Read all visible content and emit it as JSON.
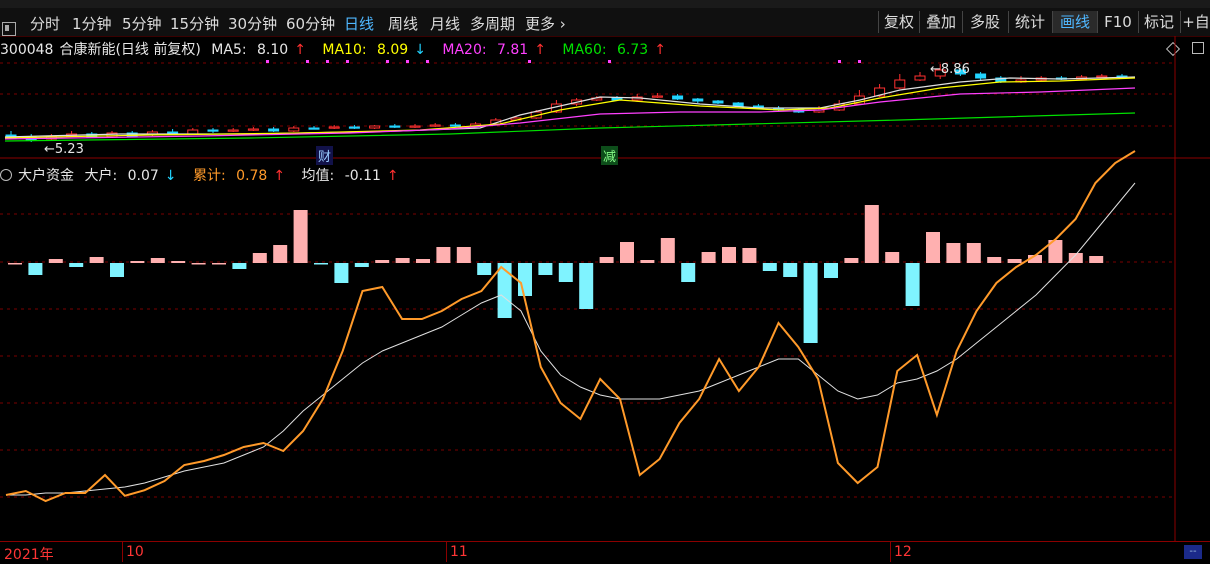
{
  "toolbar": {
    "periods": [
      "分时",
      "1分钟",
      "5分钟",
      "15分钟",
      "30分钟",
      "60分钟",
      "日线",
      "周线",
      "月线",
      "多周期",
      "更多"
    ],
    "active_period": "日线",
    "right_buttons": [
      "复权",
      "叠加",
      "多股",
      "统计",
      "画线",
      "F10",
      "标记",
      "+自"
    ],
    "active_right": "画线"
  },
  "main_chart": {
    "stock_code": "300048",
    "stock_name": "合康新能(日线 前复权)",
    "ma5": {
      "label": "MA5:",
      "value": "8.10",
      "dir": "↑"
    },
    "ma10": {
      "label": "MA10:",
      "value": "8.09",
      "dir": "↓"
    },
    "ma20": {
      "label": "MA20:",
      "value": "7.81",
      "dir": "↑"
    },
    "ma60": {
      "label": "MA60:",
      "value": "6.73",
      "dir": "↑"
    },
    "high_label": "8.86",
    "low_label": "5.23",
    "event_cai": "财",
    "event_jian": "减"
  },
  "indicator": {
    "name": "大户资金",
    "dahu": {
      "label": "大户:",
      "value": "0.07",
      "dir": "↓"
    },
    "leiji": {
      "label": "累计:",
      "value": "0.78",
      "dir": "↑"
    },
    "junzhi": {
      "label": "均值:",
      "value": "-0.11",
      "dir": "↑"
    }
  },
  "axis": {
    "labels": [
      "2021年",
      "10",
      "11",
      "12"
    ]
  },
  "colors": {
    "up": "#ff3030",
    "down": "#22d4ff",
    "bar_pos": "#ffb0b0",
    "bar_neg": "#7ff3ff",
    "leiji_line": "#ff9a2a",
    "junzhi_line": "#e0e0e0"
  },
  "chart_data": [
    {
      "type": "bar",
      "name": "大户资金-大户",
      "values": [
        0.0,
        -0.12,
        0.04,
        -0.04,
        0.06,
        -0.14,
        0.02,
        0.05,
        0.02,
        0.0,
        0.0,
        -0.06,
        0.1,
        0.18,
        0.53,
        -0.01,
        -0.2,
        -0.04,
        0.03,
        0.05,
        0.04,
        0.16,
        0.16,
        -0.12,
        -0.55,
        -0.33,
        -0.12,
        -0.19,
        -0.46,
        0.06,
        0.21,
        0.03,
        0.25,
        -0.19,
        0.11,
        0.16,
        0.15,
        -0.08,
        -0.14,
        -0.8,
        -0.15,
        0.05,
        0.58,
        0.11,
        -0.43,
        0.31,
        0.2,
        0.2,
        0.06,
        0.04,
        0.08,
        0.23,
        0.1,
        0.07
      ]
    },
    {
      "type": "line",
      "name": "累计",
      "values": [
        0.0,
        0.1,
        -0.15,
        0.05,
        0.05,
        0.5,
        -0.02,
        0.12,
        0.35,
        0.75,
        0.85,
        1.0,
        1.2,
        1.3,
        1.1,
        1.6,
        2.4,
        3.6,
        5.1,
        5.2,
        4.4,
        4.4,
        4.6,
        4.9,
        5.1,
        5.7,
        5.3,
        3.2,
        2.3,
        1.9,
        2.9,
        2.4,
        0.5,
        0.9,
        1.8,
        2.4,
        3.4,
        2.6,
        3.2,
        4.3,
        3.7,
        2.9,
        0.8,
        0.3,
        0.7,
        3.1,
        3.5,
        2.0,
        3.6,
        4.6,
        5.3,
        5.7,
        6.0,
        6.4,
        6.9,
        7.8,
        8.3,
        8.6
      ]
    },
    {
      "type": "line",
      "name": "均值",
      "values": [
        0.0,
        0.0,
        0.05,
        0.05,
        0.1,
        0.15,
        0.2,
        0.3,
        0.45,
        0.6,
        0.7,
        0.8,
        1.0,
        1.2,
        1.6,
        2.1,
        2.5,
        2.9,
        3.3,
        3.6,
        3.8,
        4.0,
        4.2,
        4.5,
        4.8,
        5.0,
        4.6,
        3.6,
        3.0,
        2.7,
        2.5,
        2.4,
        2.4,
        2.4,
        2.5,
        2.6,
        2.8,
        3.0,
        3.2,
        3.4,
        3.4,
        3.0,
        2.6,
        2.4,
        2.5,
        2.8,
        2.9,
        3.1,
        3.4,
        3.8,
        4.2,
        4.6,
        5.0,
        5.5,
        6.0,
        6.6,
        7.2,
        7.8
      ]
    }
  ]
}
